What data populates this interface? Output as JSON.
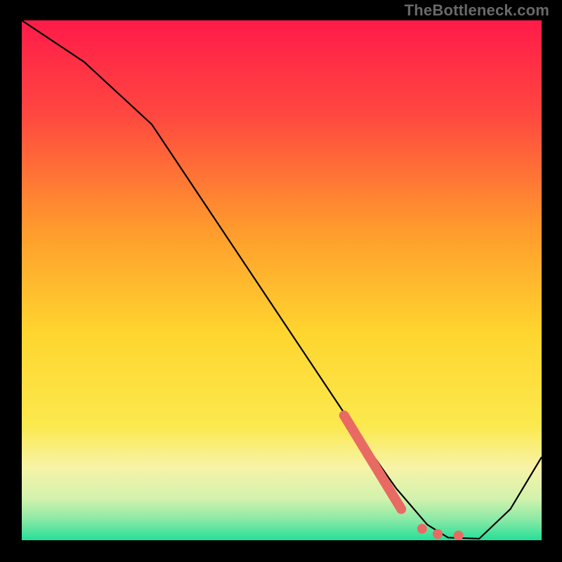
{
  "watermark": "TheBottleneck.com",
  "colors": {
    "background": "#000000",
    "gradient_top": "#ff1b49",
    "gradient_mid1": "#ff8a2d",
    "gradient_mid2": "#ffd52e",
    "gradient_mid3": "#faf18b",
    "gradient_mid4": "#baf1a5",
    "gradient_bottom": "#2fe09b",
    "line": "#000000",
    "highlight": "#e96a62"
  },
  "chart_data": {
    "type": "line",
    "title": "",
    "xlabel": "",
    "ylabel": "",
    "xlim": [
      0,
      100
    ],
    "ylim": [
      0,
      100
    ],
    "series": [
      {
        "name": "curve",
        "x": [
          0,
          12,
          25,
          35,
          45,
          55,
          65,
          72,
          78,
          82,
          88,
          94,
          100
        ],
        "y": [
          100,
          92,
          80,
          65,
          50,
          35,
          20,
          10,
          3,
          0.5,
          0.3,
          6,
          16
        ]
      }
    ],
    "highlight_segment": {
      "start": {
        "x": 62,
        "y": 24
      },
      "end": {
        "x": 73,
        "y": 6
      }
    },
    "highlight_dots": [
      {
        "x": 77,
        "y": 2.2
      },
      {
        "x": 80,
        "y": 1.2
      },
      {
        "x": 84,
        "y": 0.9
      }
    ]
  }
}
